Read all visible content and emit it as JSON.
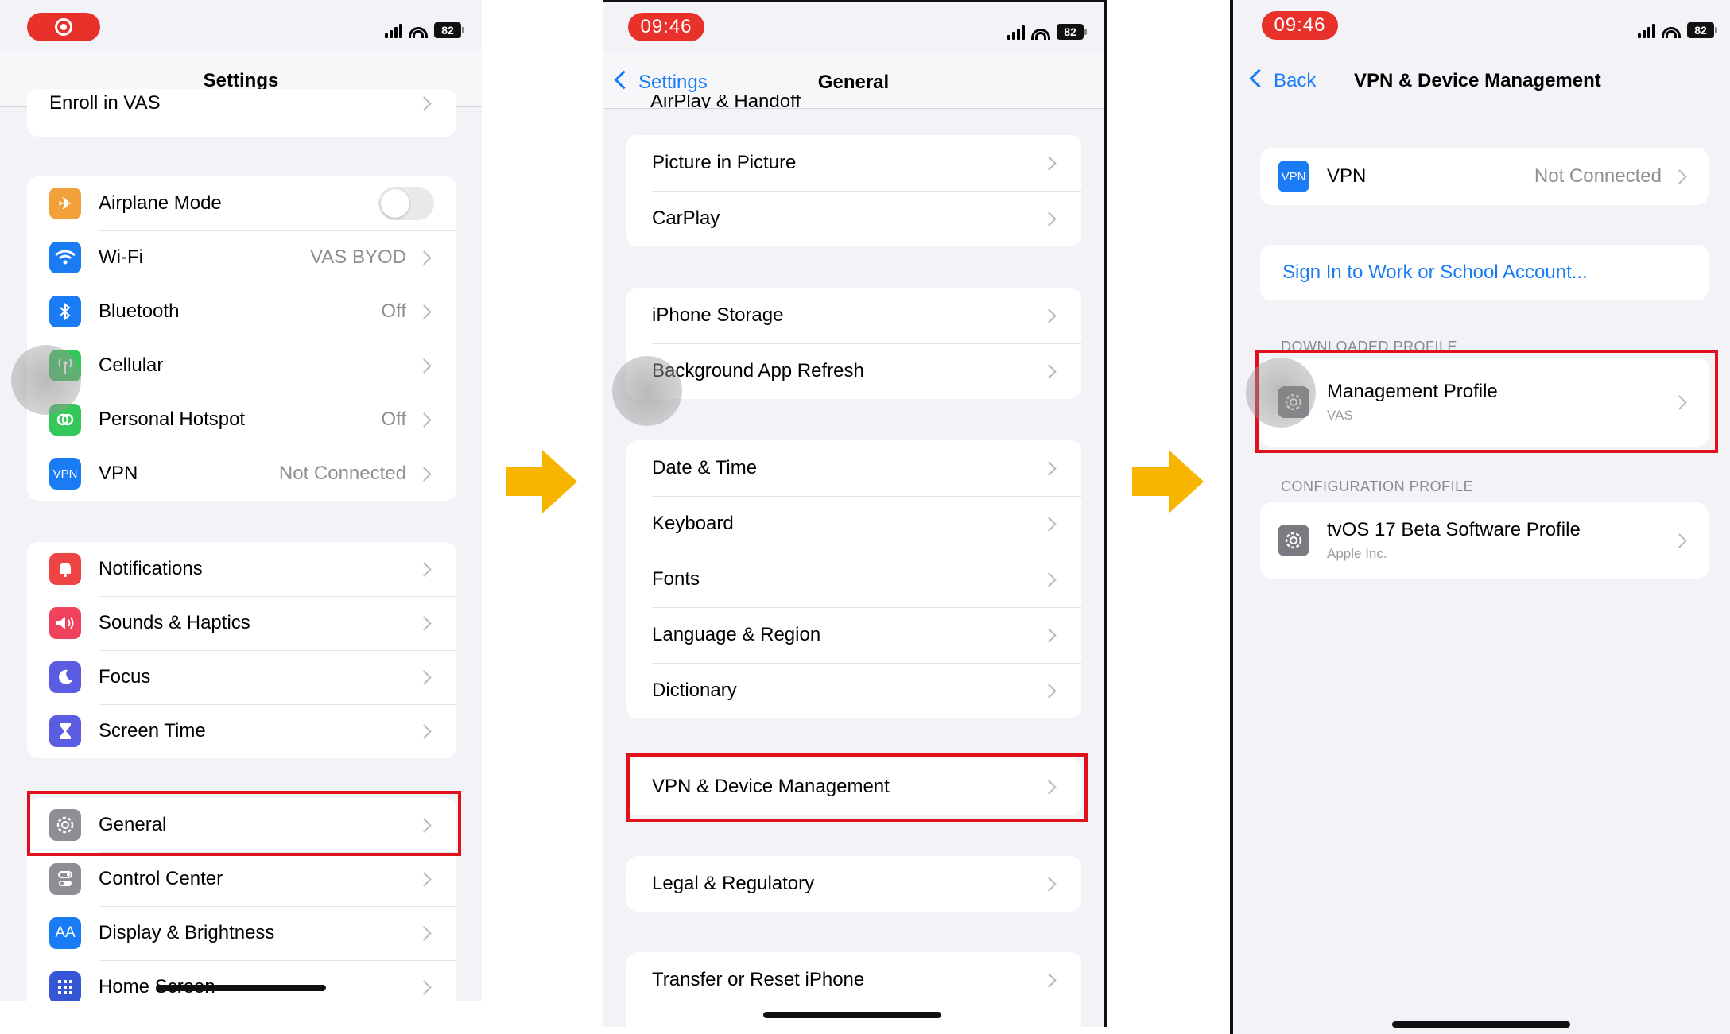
{
  "status": {
    "time": "09:46",
    "battery": "82"
  },
  "panel1": {
    "title": "Settings",
    "top_partial": "Enroll in VAS",
    "group1": [
      {
        "label": "Airplane Mode",
        "icon": "airplane-icon",
        "color": "#f2a03a"
      },
      {
        "label": "Wi-Fi",
        "value": "VAS BYOD",
        "icon": "wifi-icon",
        "color": "#1a7cf5"
      },
      {
        "label": "Bluetooth",
        "value": "Off",
        "icon": "bluetooth-icon",
        "color": "#1a7cf5"
      },
      {
        "label": "Cellular",
        "icon": "antenna-icon",
        "color": "#34c759"
      },
      {
        "label": "Personal Hotspot",
        "value": "Off",
        "icon": "hotspot-icon",
        "color": "#34c759"
      },
      {
        "label": "VPN",
        "value": "Not Connected",
        "icon": "vpn-icon",
        "color": "#1a7cf5"
      }
    ],
    "group2": [
      {
        "label": "Notifications",
        "icon": "bell-icon",
        "color": "#ef4444"
      },
      {
        "label": "Sounds & Haptics",
        "icon": "speaker-icon",
        "color": "#f0415d"
      },
      {
        "label": "Focus",
        "icon": "moon-icon",
        "color": "#5b5ce2"
      },
      {
        "label": "Screen Time",
        "icon": "hourglass-icon",
        "color": "#5b5ce2"
      }
    ],
    "group3": [
      {
        "label": "General",
        "icon": "gear-icon",
        "color": "#8e8e93"
      },
      {
        "label": "Control Center",
        "icon": "switches-icon",
        "color": "#8e8e93"
      },
      {
        "label": "Display & Brightness",
        "icon": "text-size-icon",
        "color": "#1a7cf5"
      },
      {
        "label": "Home Screen",
        "icon": "grid-icon",
        "color": "#3556d6"
      }
    ],
    "vpn_icon_text": "VPN",
    "aa_icon_text": "AA"
  },
  "panel2": {
    "back": "Settings",
    "title": "General",
    "top_partial": "AirPlay & Handoff",
    "groupA": [
      "Picture in Picture",
      "CarPlay"
    ],
    "groupB": [
      "iPhone Storage",
      "Background App Refresh"
    ],
    "groupC": [
      "Date & Time",
      "Keyboard",
      "Fonts",
      "Language & Region",
      "Dictionary"
    ],
    "groupD": [
      "VPN & Device Management"
    ],
    "groupE": [
      "Legal & Regulatory"
    ],
    "groupF": [
      "Transfer or Reset iPhone"
    ]
  },
  "panel3": {
    "back": "Back",
    "title": "VPN & Device Management",
    "vpn": {
      "label": "VPN",
      "value": "Not Connected",
      "icon_text": "VPN"
    },
    "sign_in": "Sign In to Work or School Account...",
    "downloaded_header": "DOWNLOADED PROFILE",
    "management": {
      "label": "Management Profile",
      "sub": "VAS"
    },
    "config_header": "CONFIGURATION PROFILE",
    "config": {
      "label": "tvOS 17 Beta Software Profile",
      "sub": "Apple Inc."
    }
  }
}
